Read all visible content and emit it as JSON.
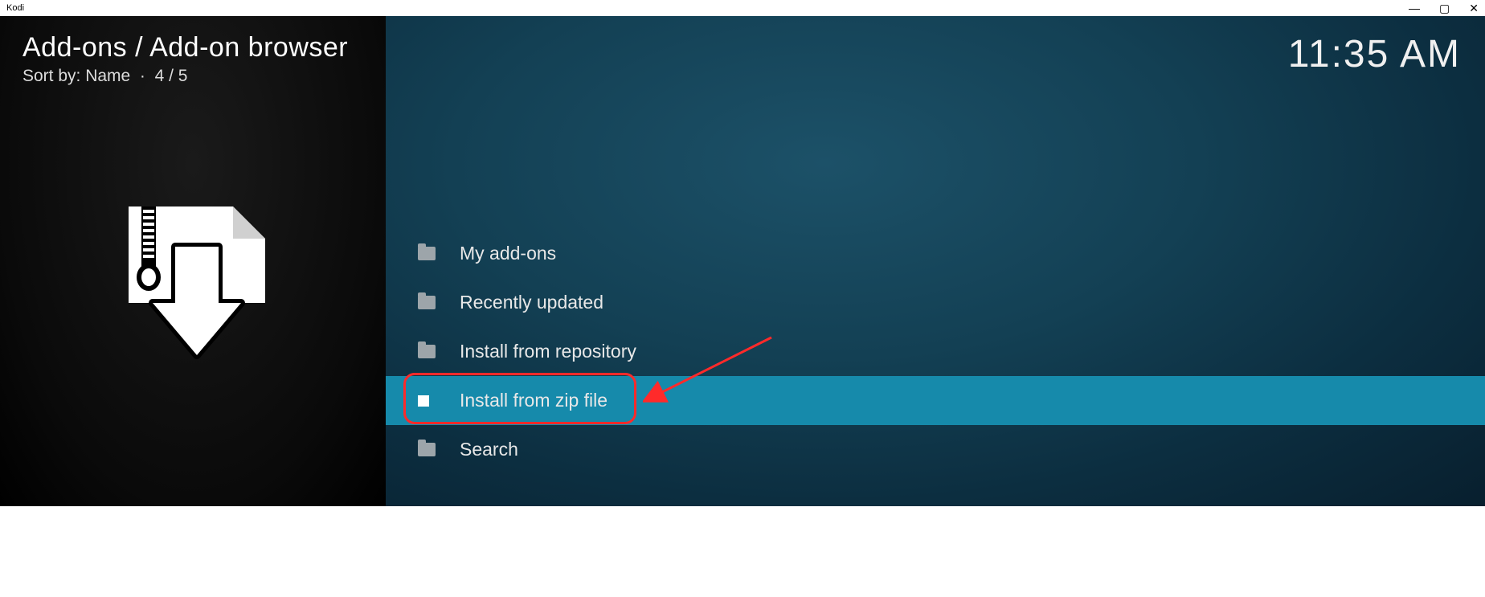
{
  "window": {
    "title": "Kodi"
  },
  "header": {
    "breadcrumb": "Add-ons / Add-on browser",
    "sort_prefix": "Sort by: ",
    "sort_value": "Name",
    "counter": "4 / 5"
  },
  "clock": "11:35 AM",
  "menu": {
    "items": [
      {
        "label": "My add-ons",
        "icon": "folder",
        "selected": false
      },
      {
        "label": "Recently updated",
        "icon": "folder",
        "selected": false
      },
      {
        "label": "Install from repository",
        "icon": "folder",
        "selected": false
      },
      {
        "label": "Install from zip file",
        "icon": "file",
        "selected": true
      },
      {
        "label": "Search",
        "icon": "folder",
        "selected": false
      }
    ]
  },
  "annotation": {
    "highlight_index": 3
  }
}
